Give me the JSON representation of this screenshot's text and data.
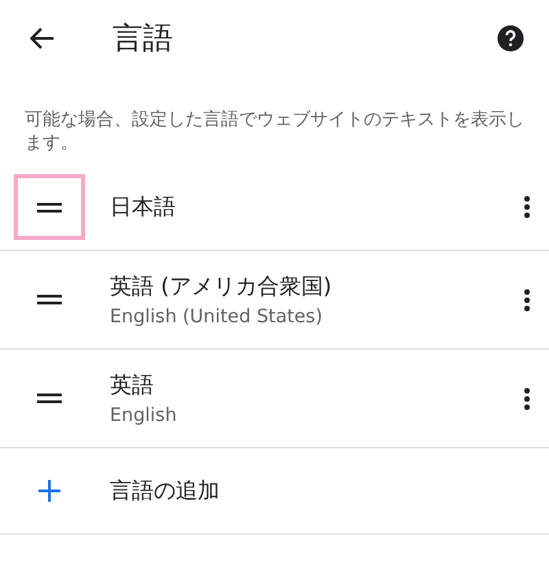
{
  "header": {
    "title": "言語"
  },
  "description": "可能な場合、設定した言語でウェブサイトのテキストを表示します。",
  "languages": [
    {
      "name": "日本語",
      "highlighted": true
    },
    {
      "name": "英語 (アメリカ合衆国)",
      "subtitle": "English (United States)",
      "highlighted": false
    },
    {
      "name": "英語",
      "subtitle": "English",
      "highlighted": false
    }
  ],
  "add_language": {
    "label": "言語の追加"
  }
}
